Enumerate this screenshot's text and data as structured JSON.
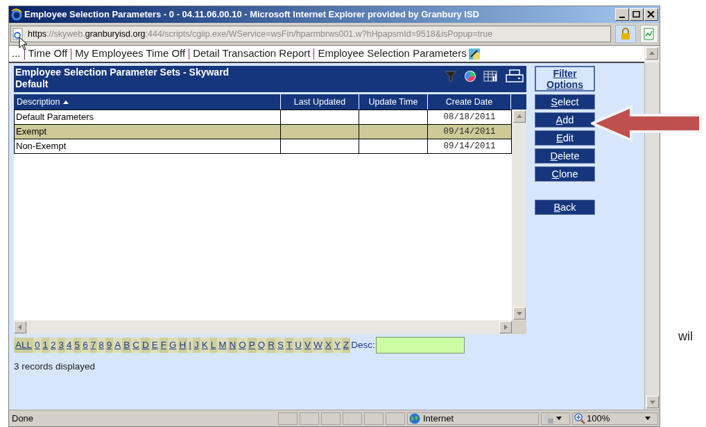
{
  "window": {
    "title": "Employee Selection Parameters - 0 - 04.11.06.00.10 - Microsoft Internet Explorer provided by Granbury ISD"
  },
  "address": [
    {
      "text": "https",
      "dim": false
    },
    {
      "text": "://skyweb.",
      "dim": true
    },
    {
      "text": "granburyisd.org",
      "dim": false
    },
    {
      "text": ":444/scripts/cgiip.exe/WService=wsFin/hparmbrws001.w?hHpapsmId=9518&isPopup=true",
      "dim": true
    }
  ],
  "breadcrumbs": [
    "...",
    "Time Off",
    "My Employees Time Off",
    "Detail Transaction Report",
    "Employee Selection Parameters"
  ],
  "panel": {
    "title": "Employee Selection Parameter Sets - Skyward Default",
    "columns": [
      {
        "label": "Description",
        "sorted": true
      },
      {
        "label": "Last Updated",
        "sorted": false
      },
      {
        "label": "Update Time",
        "sorted": false
      },
      {
        "label": "Create Date",
        "sorted": false
      }
    ],
    "rows": [
      {
        "description": "Default Parameters",
        "create_date": "08/18/2011",
        "selected": false
      },
      {
        "description": "Exempt",
        "create_date": "09/14/2011",
        "selected": true
      },
      {
        "description": "Non-Exempt",
        "create_date": "09/14/2011",
        "selected": false
      }
    ]
  },
  "alpha_filter": [
    "ALL",
    "0",
    "1",
    "2",
    "3",
    "4",
    "5",
    "6",
    "7",
    "8",
    "9",
    "A",
    "B",
    "C",
    "D",
    "E",
    "F",
    "G",
    "H",
    "I",
    "J",
    "K",
    "L",
    "M",
    "N",
    "O",
    "P",
    "Q",
    "R",
    "S",
    "T",
    "U",
    "V",
    "W",
    "X",
    "Y",
    "Z"
  ],
  "desc_label": "Desc:",
  "record_count": "3 records displayed",
  "filter_options": "Filter Options",
  "actions": [
    "Select",
    "Add",
    "Edit",
    "Delete",
    "Clone"
  ],
  "back_button": "Back",
  "status": {
    "text": "Done",
    "zone": "Internet",
    "zoom": "100%"
  },
  "side_text": "wil"
}
